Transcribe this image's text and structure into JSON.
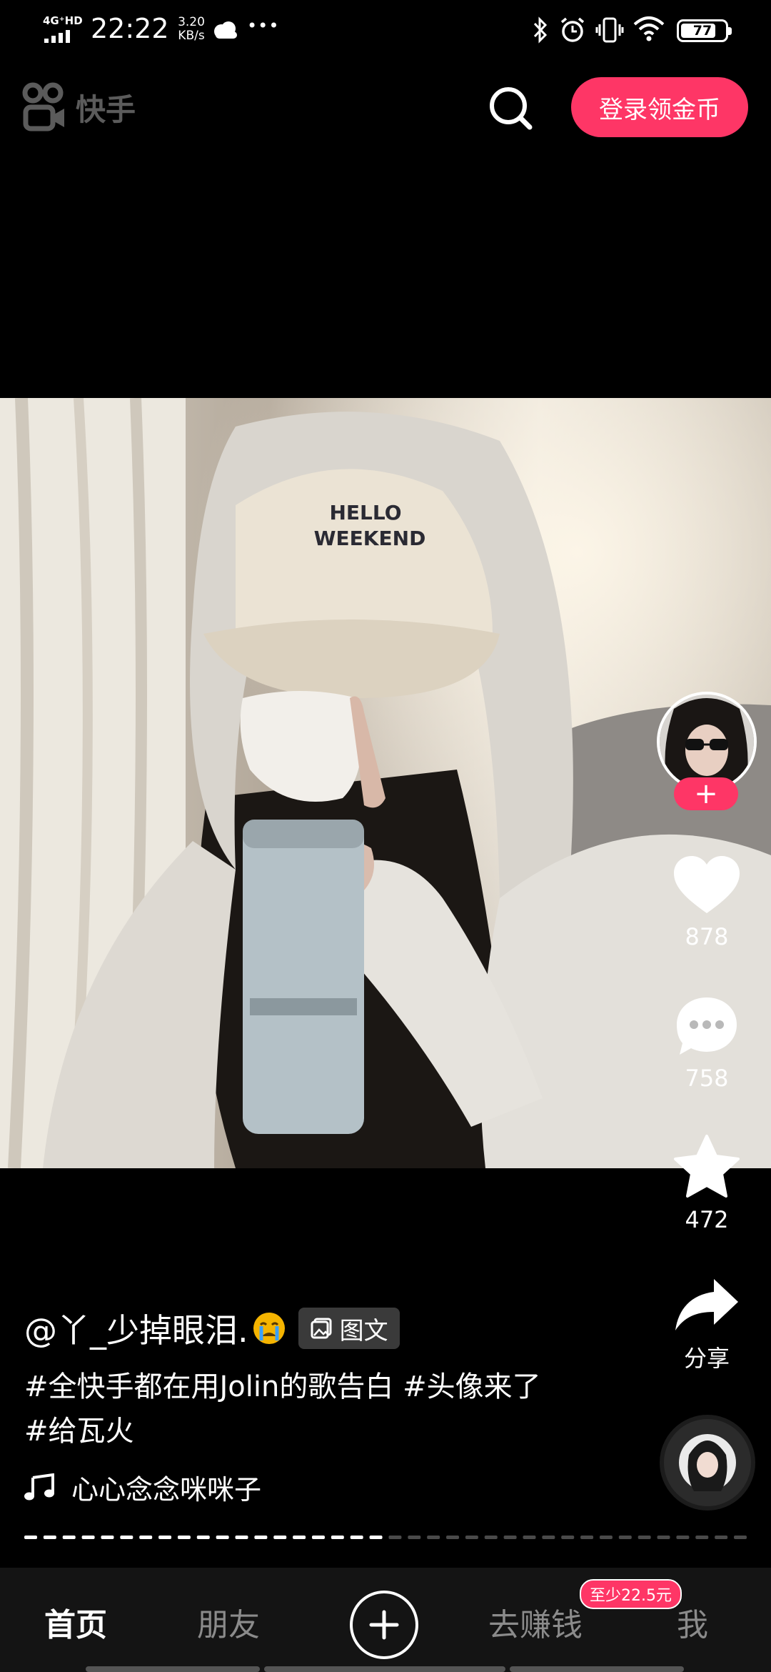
{
  "status_bar": {
    "network": "4G⁺HD",
    "time": "22:22",
    "speed_value": "3.20",
    "speed_unit": "KB/s",
    "more": "•••",
    "battery": "77"
  },
  "header": {
    "logo_text": "快手",
    "login_button": "登录领金币"
  },
  "post": {
    "author": "@丫_少掉眼泪.",
    "type_badge": "图文",
    "description": "#全快手都在用Jolin的歌告白 #头像来了 #给瓦火",
    "music": "心心念念咪咪子",
    "progress_fraction": 0.5
  },
  "side_actions": {
    "follow": "+",
    "likes": "878",
    "comments": "758",
    "favorites": "472",
    "share": "分享"
  },
  "bottom_nav": {
    "home": "首页",
    "friends": "朋友",
    "earn": "去赚钱",
    "earn_badge": "至少22.5元",
    "me": "我"
  },
  "icons": [
    "kuaishou-logo-icon",
    "search-icon",
    "heart-icon",
    "comment-icon",
    "star-icon",
    "share-icon",
    "music-note-icon",
    "image-icon",
    "plus-icon",
    "bluetooth-icon",
    "alarm-icon",
    "vibrate-icon",
    "wifi-icon",
    "cloud-icon"
  ],
  "colors": {
    "accent": "#fe3666",
    "background": "#000000",
    "nav_bg": "#141414"
  }
}
